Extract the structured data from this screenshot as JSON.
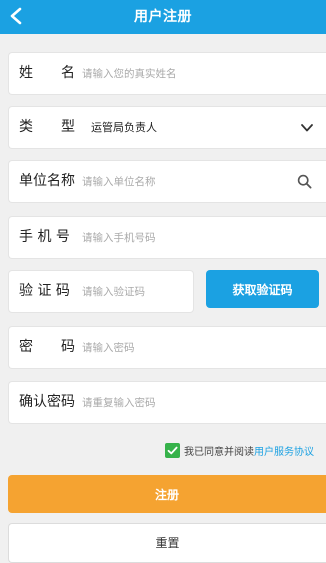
{
  "header": {
    "title": "用户注册",
    "back_icon": "chevron-left-icon"
  },
  "form": {
    "name": {
      "label": "姓　　名",
      "placeholder": "请输入您的真实姓名",
      "value": ""
    },
    "type": {
      "label": "类　　型",
      "value": "运管局负责人",
      "icon": "chevron-down-icon"
    },
    "unit": {
      "label": "单位名称",
      "placeholder": "请输入单位名称",
      "value": "",
      "icon": "search-icon"
    },
    "phone": {
      "label": "手 机 号",
      "placeholder": "请输入手机号码",
      "value": ""
    },
    "code": {
      "label": "验 证 码",
      "placeholder": "请输入验证码",
      "value": ""
    },
    "password": {
      "label": "密　　码",
      "placeholder": "请输入密码",
      "value": ""
    },
    "confirm": {
      "label": "确认密码",
      "placeholder": "请重复输入密码",
      "value": ""
    }
  },
  "code_button": {
    "label": "获取验证码"
  },
  "agreement": {
    "checked": true,
    "text": "我已同意并阅读",
    "link": "用户服务协议"
  },
  "buttons": {
    "submit": "注册",
    "reset": "重置"
  },
  "colors": {
    "primary": "#1ba1e2",
    "submit": "#f5a331",
    "check": "#36b24a",
    "background": "#f0f0f0"
  }
}
